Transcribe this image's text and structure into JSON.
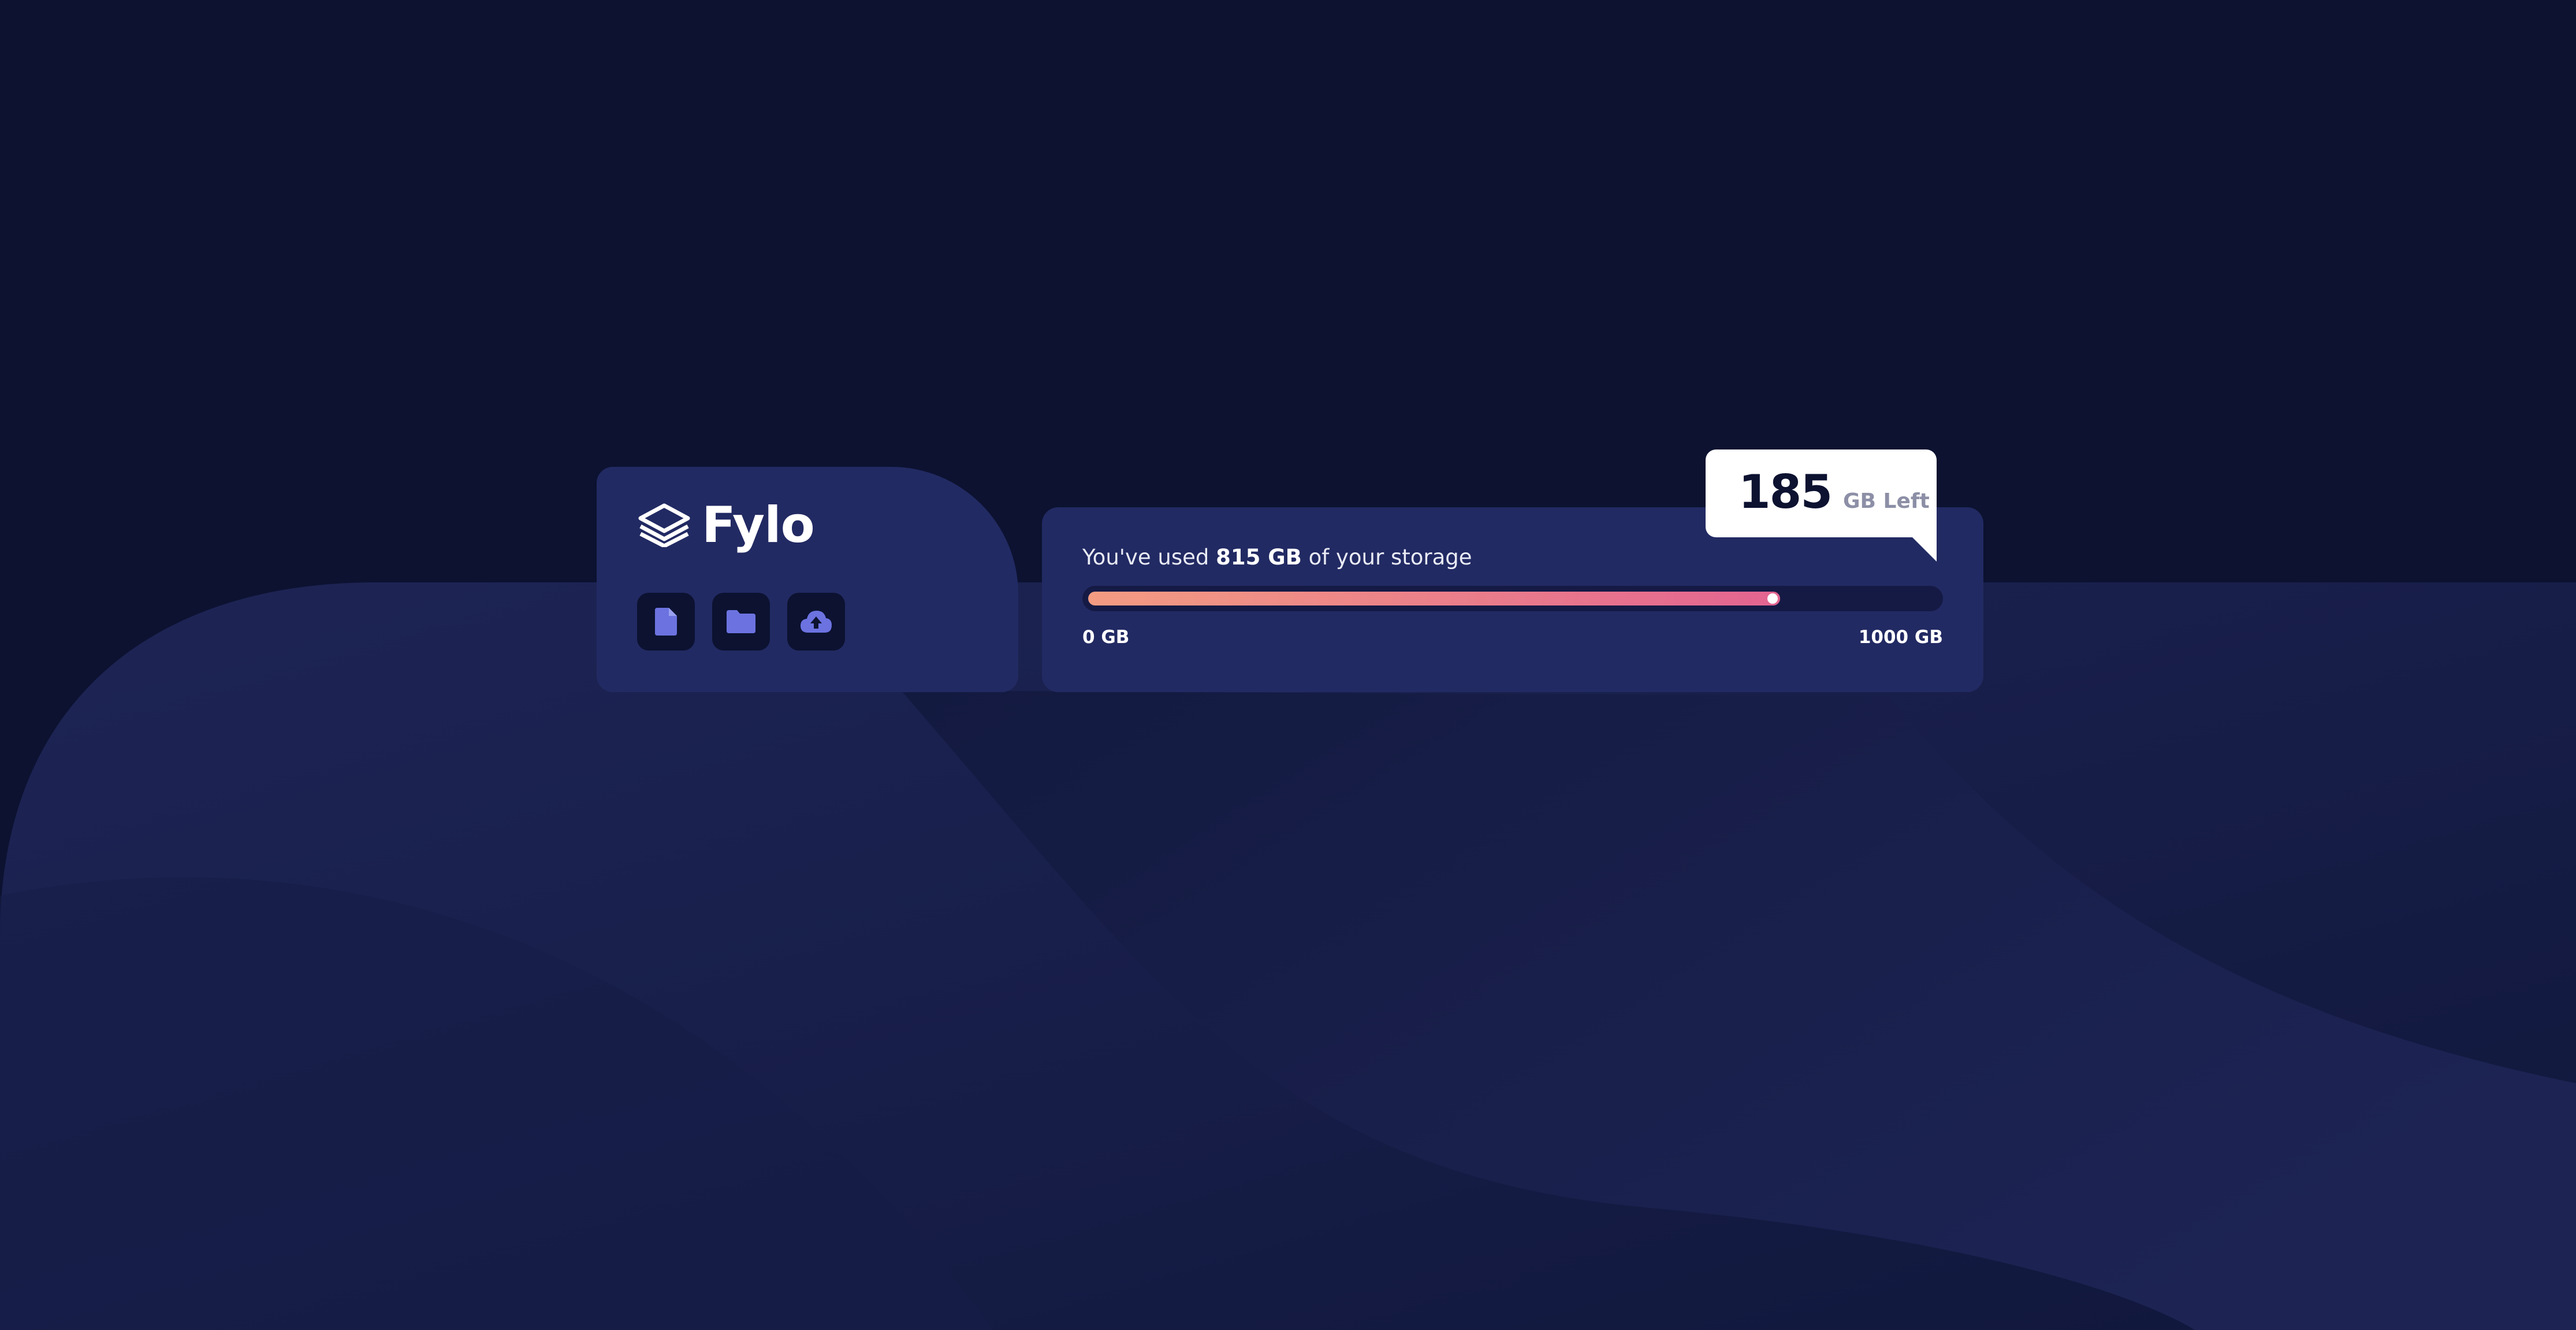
{
  "brand": {
    "name": "Fylo"
  },
  "icons": [
    {
      "name": "document-icon",
      "label": "Documents"
    },
    {
      "name": "folder-icon",
      "label": "Folders"
    },
    {
      "name": "upload-icon",
      "label": "Upload"
    }
  ],
  "storage": {
    "prefix": "You've used",
    "used": "815 GB",
    "suffix": "of your storage",
    "used_value": 815,
    "total_value": 1000,
    "min_label": "0 GB",
    "max_label": "1000 GB",
    "remaining": "185",
    "remaining_unit": "GB Left"
  },
  "colors": {
    "background": "#0c1230",
    "card": "#222a63",
    "accent_start": "#f39c82",
    "accent_end": "#e36491",
    "icon": "#6c73e0"
  }
}
